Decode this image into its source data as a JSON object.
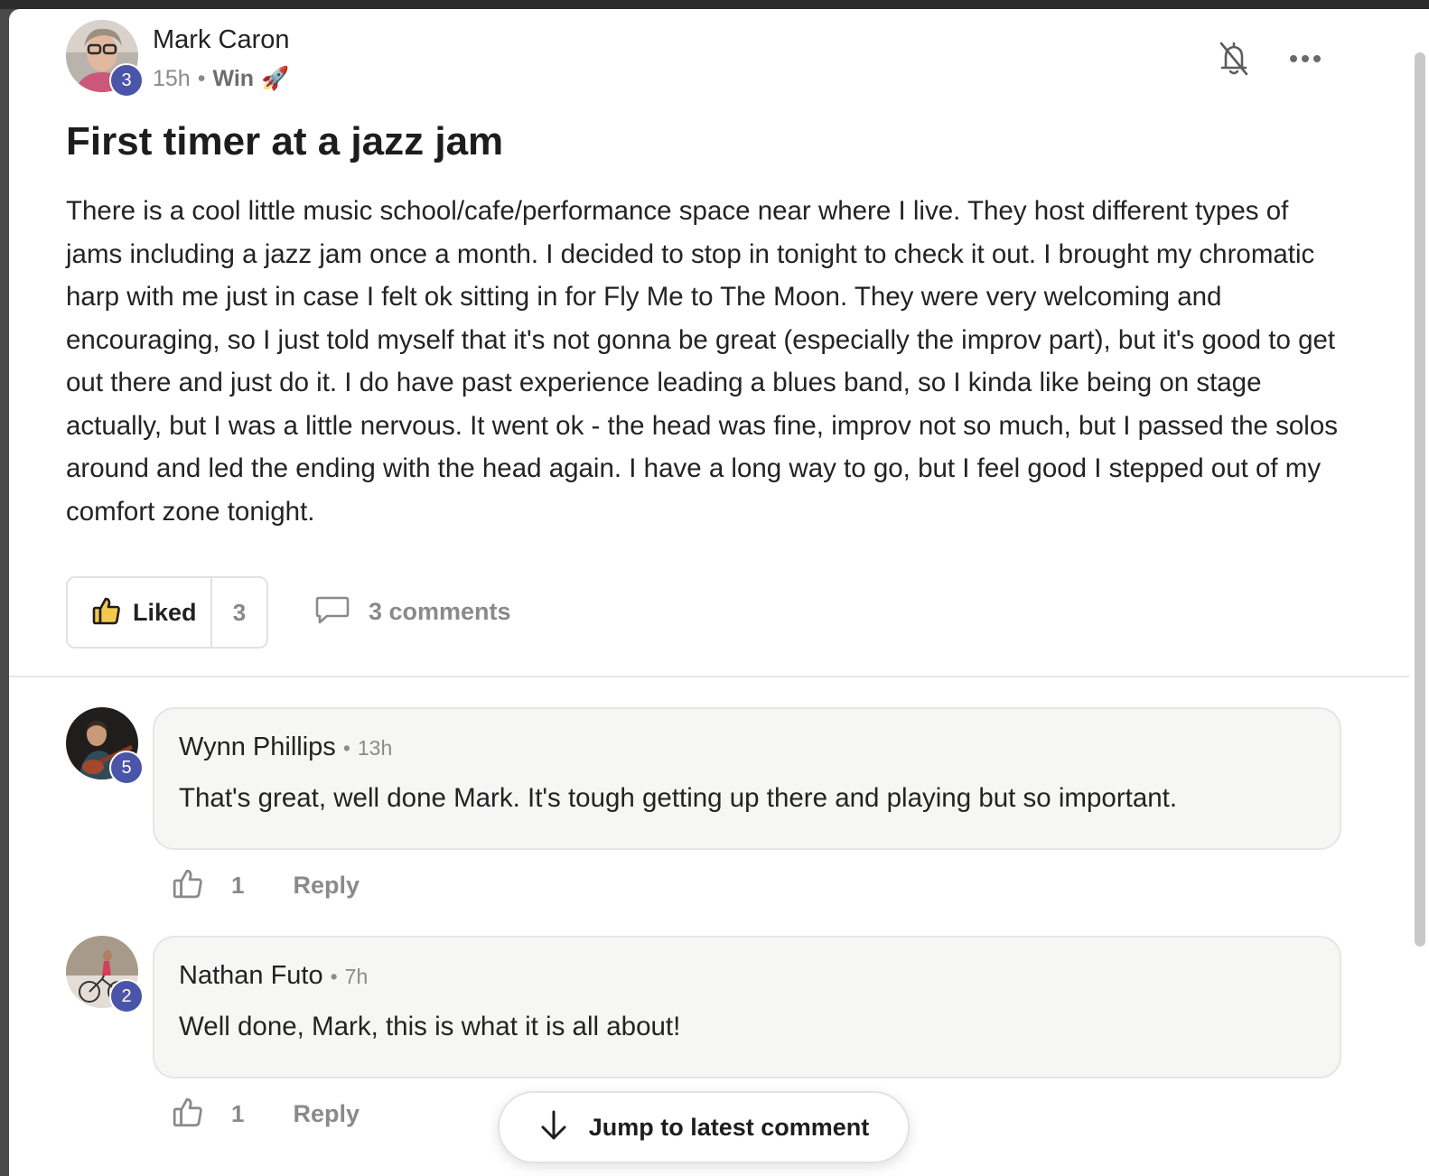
{
  "post": {
    "author": "Mark Caron",
    "author_level": "3",
    "time": "15h",
    "separator": "•",
    "category": "Win",
    "category_emoji": "🚀",
    "title": "First timer at a jazz jam",
    "body": "There is a cool little music school/cafe/performance space near where I live. They host different types of jams including a jazz jam once a month. I decided to stop in tonight to check it out. I brought my chromatic harp with me just in case I felt ok sitting in for Fly Me to The Moon. They were very welcoming and encouraging, so I just told myself that it's not gonna be great (especially the improv part), but it's good to get out there and just do it. I do have past experience leading a blues band, so I kinda like being on stage actually, but I was a little nervous. It went ok - the head was fine, improv not so much, but I passed the solos around and led the ending with the head again. I have a long way to go, but I feel good I stepped out of my comfort zone tonight.",
    "like_label": "Liked",
    "like_count": "3",
    "comments_label": "3 comments",
    "icons": {
      "notify": "bell-off-icon",
      "more": "more-icon",
      "like": "thumbs-up-icon",
      "comment": "comment-icon"
    }
  },
  "comments": [
    {
      "author": "Wynn Phillips",
      "author_level": "5",
      "time": "13h",
      "separator": "•",
      "text": "That's great, well done Mark. It's tough getting up there and playing but so important.",
      "like_count": "1",
      "reply_label": "Reply"
    },
    {
      "author": "Nathan Futo",
      "author_level": "2",
      "time": "7h",
      "separator": "•",
      "text": "Well done, Mark, this is what it is all about!",
      "like_count": "1",
      "reply_label": "Reply"
    }
  ],
  "jump_button": {
    "label": "Jump to latest comment",
    "icon": "arrow-down-icon"
  },
  "colors": {
    "level_badge": "#4a55a9",
    "text": "#232323",
    "muted": "#8a8a8a",
    "bubble_bg": "#f6f6f5"
  }
}
